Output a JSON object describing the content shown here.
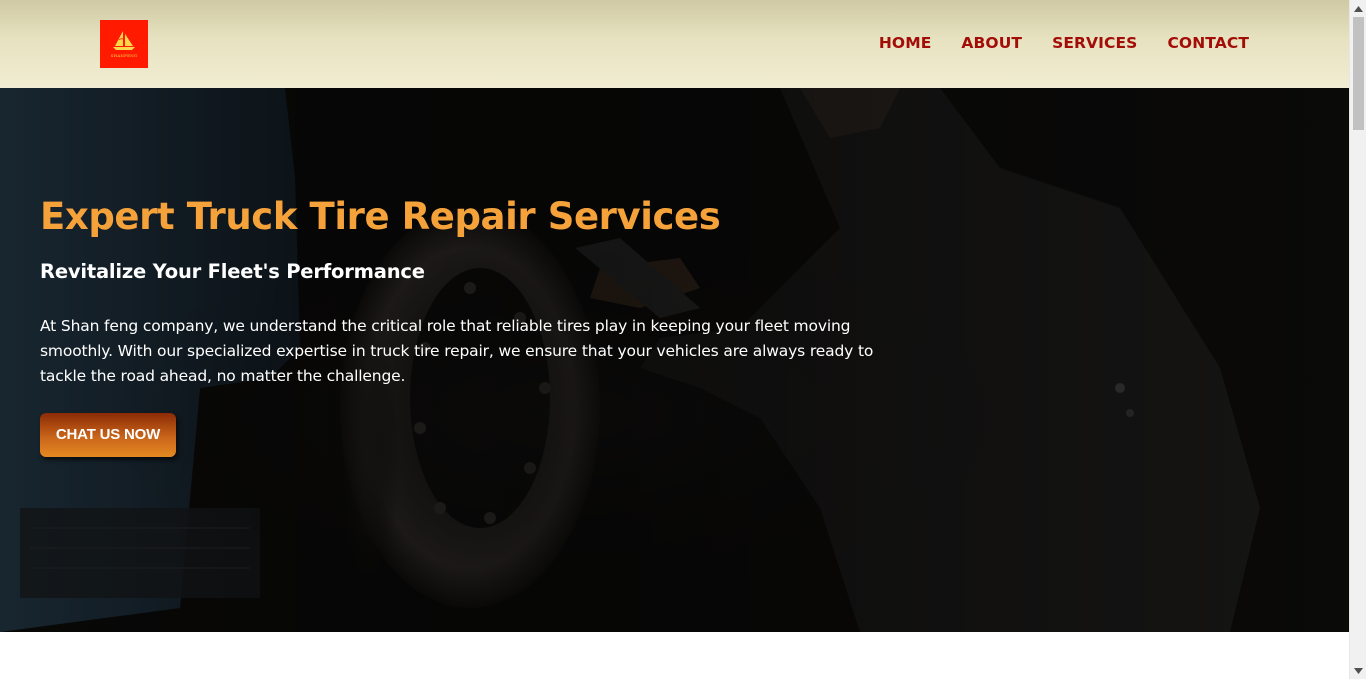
{
  "brand": {
    "logo_text": "SHANFENG",
    "logo_color": "#ff1a00"
  },
  "nav": {
    "items": [
      {
        "label": "HOME"
      },
      {
        "label": "ABOUT"
      },
      {
        "label": "SERVICES"
      },
      {
        "label": "CONTACT"
      }
    ],
    "color": "#a30d08"
  },
  "hero": {
    "title": "Expert Truck Tire Repair Services",
    "subtitle": "Revitalize Your Fleet's Performance",
    "description": "At Shan feng company, we understand the critical role that reliable tires play in keeping your fleet moving smoothly. With our specialized expertise in truck tire repair, we ensure that your vehicles are always ready to tackle the road ahead, no matter the challenge.",
    "cta_label": "CHAT US NOW",
    "title_color": "#f6a23a"
  },
  "icons": {
    "logo": "sailboat-logo-icon",
    "scroll_up": "chevron-up-icon",
    "scroll_down": "chevron-down-icon"
  }
}
